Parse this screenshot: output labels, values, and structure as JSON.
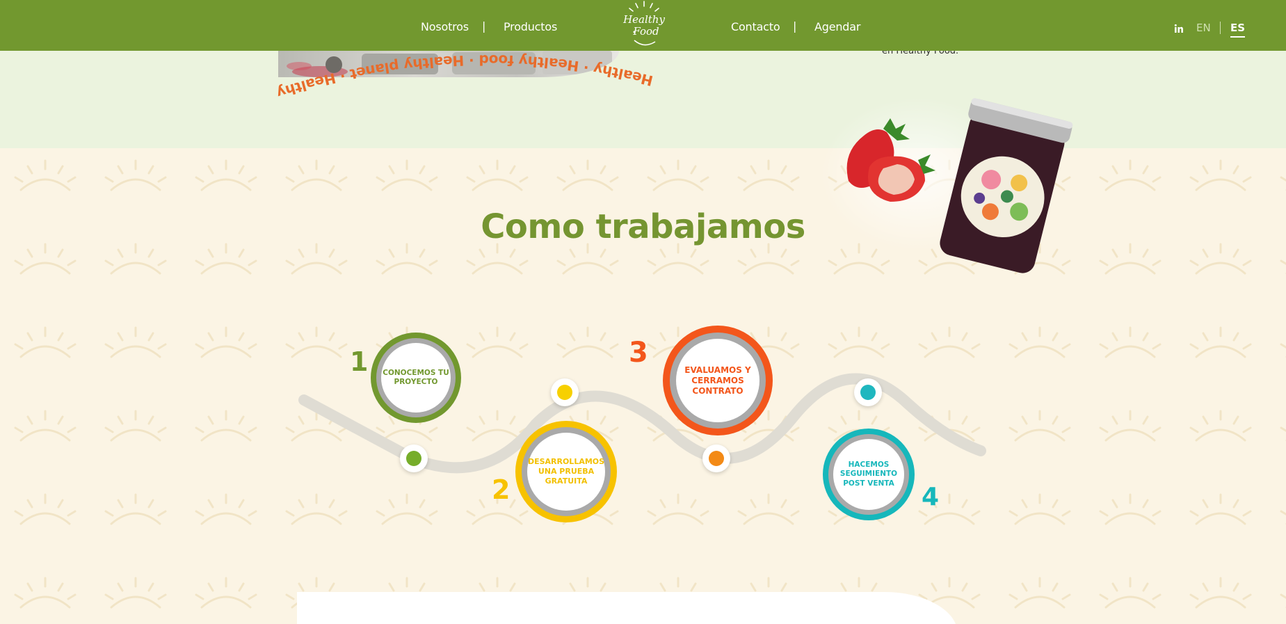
{
  "header": {
    "nav_left": [
      "Nosotros",
      "Productos"
    ],
    "nav_right": [
      "Contacto",
      "Agendar"
    ],
    "separator": "|",
    "logo_line1": "Healthy",
    "logo_line2": "Food",
    "languages": [
      "EN",
      "ES"
    ],
    "active_language": "ES"
  },
  "hero_fragment": {
    "circular_text": "Healthy · Healthy food · Healthy planet · Healthy life · life",
    "about_snippet": "en Healthy Food."
  },
  "section": {
    "title": "Como trabajamos"
  },
  "steps": [
    {
      "number": "1",
      "label_lines": [
        "CONOCEMOS TU",
        "PROYECTO"
      ]
    },
    {
      "number": "2",
      "label_lines": [
        "DESARROLLAMOS",
        "UNA PRUEBA",
        "GRATUITA"
      ]
    },
    {
      "number": "3",
      "label_lines": [
        "EVALUAMOS Y",
        "CERRAMOS",
        "CONTRATO"
      ]
    },
    {
      "number": "4",
      "label_lines": [
        "HACEMOS",
        "SEGUIMIENTO",
        "POST VENTA"
      ]
    }
  ],
  "colors": {
    "brand_green": "#72982f",
    "title_green": "#759531",
    "step1": "#72982f",
    "step2": "#f7c200",
    "step3": "#f3561b",
    "step4": "#16b7bb",
    "circular_text": "#e86b2a"
  },
  "icons": {
    "linkedin": "linkedin-icon",
    "logo_sun": "sun-logo-icon"
  }
}
